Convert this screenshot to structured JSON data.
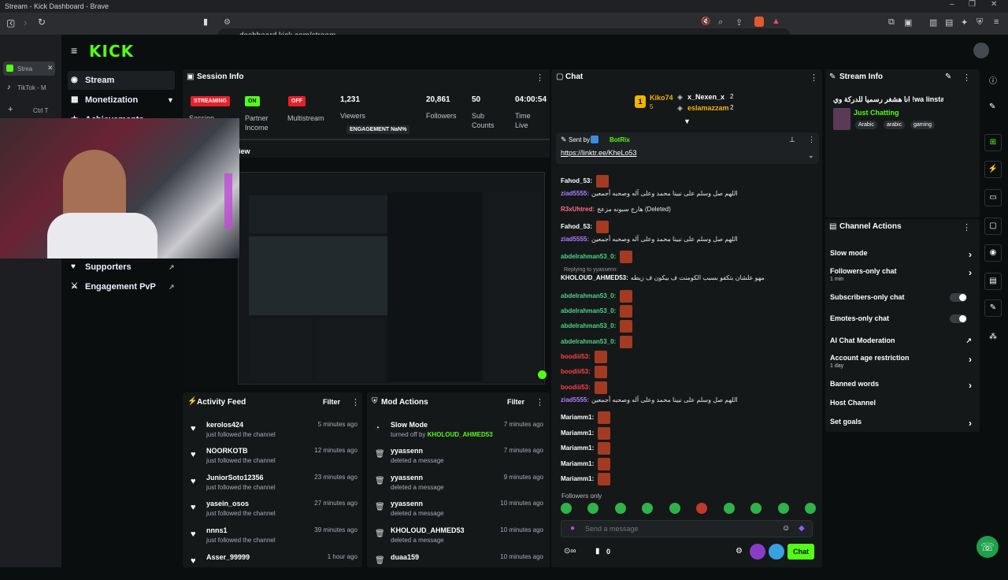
{
  "browser": {
    "tab_title": "Stream - Kick Dashboard - Brave",
    "url": "dashboard.kick.com/stream",
    "tabs": [
      {
        "label": "Strea"
      },
      {
        "label": "TikTok - M"
      }
    ],
    "shortcut": "Ctrl T"
  },
  "app": {
    "logo": "KICK"
  },
  "sidebar": {
    "items": [
      {
        "label": "Stream"
      },
      {
        "label": "Monetization"
      },
      {
        "label": "Achievements"
      },
      {
        "label": "Supporters"
      },
      {
        "label": "Engagement PvP"
      }
    ]
  },
  "session": {
    "title": "Session Info",
    "streaming_badge": "STREAMING",
    "session_label": "Session",
    "partner_badge": "ON",
    "partner_label_1": "Partner",
    "partner_label_2": "Income",
    "multistream_badge": "OFF",
    "multistream_label": "Multistream",
    "viewers_value": "1,231",
    "viewers_label": "Viewers",
    "engagement": "ENGAGEMENT NaN%",
    "followers_value": "20,861",
    "followers_label": "Followers",
    "subs_value": "50",
    "subs_label_1": "Sub",
    "subs_label_2": "Counts",
    "time_value": "04:00:54",
    "time_label_1": "Time",
    "time_label_2": "Live",
    "preview_label": "view"
  },
  "activity": {
    "title": "Activity Feed",
    "filter": "Filter",
    "rows": [
      {
        "name": "kerolos424",
        "sub": "just followed the channel",
        "time": "5 minutes ago"
      },
      {
        "name": "NOORKOTB",
        "sub": "just followed the channel",
        "time": "12 minutes ago"
      },
      {
        "name": "JuniorSoto12356",
        "sub": "just followed the channel",
        "time": "23 minutes ago"
      },
      {
        "name": "yasein_osos",
        "sub": "just followed the channel",
        "time": "27 minutes ago"
      },
      {
        "name": "nnns1",
        "sub": "just followed the channel",
        "time": "39 minutes ago"
      },
      {
        "name": "Asser_99999",
        "sub": "",
        "time": "1 hour ago"
      }
    ]
  },
  "mod": {
    "title": "Mod Actions",
    "filter": "Filter",
    "rows": [
      {
        "name": "Slow Mode",
        "sub": "turned off by ",
        "by": "KHOLOUD_AHMED53",
        "time": "7 minutes ago"
      },
      {
        "name": "yyassenn",
        "sub": "deleted a message",
        "by": "",
        "time": "7 minutes ago"
      },
      {
        "name": "yyassenn",
        "sub": "deleted a message",
        "by": "",
        "time": "9 minutes ago"
      },
      {
        "name": "yyassenn",
        "sub": "deleted a message",
        "by": "",
        "time": "10 minutes ago"
      },
      {
        "name": "KHOLOUD_AHMED53",
        "sub": "deleted a message",
        "by": "",
        "time": "10 minutes ago"
      },
      {
        "name": "duaa159",
        "sub": "",
        "by": "",
        "time": "10 minutes ago"
      }
    ]
  },
  "chat": {
    "title": "Chat",
    "leader1": "Kiko74",
    "leader1_count": "5",
    "leader2": "x_Nexen_x",
    "leader2_count": "2",
    "leader3": "eslamazzam",
    "leader3_count": "2",
    "pinned_by": "Sent by",
    "pinned_user": "BotRix",
    "pinned_link": "https://linktr.ee/KheLo53",
    "lines": [
      {
        "user": "Fahod_53:",
        "color": "#ffffff",
        "text": "",
        "emotes": 1
      },
      {
        "user": "ziad5555:",
        "color": "#b07cff",
        "text": "اللهم صل وسلم على نبينا محمد وعلى آله وصحبه أجمعين",
        "emotes": 0
      },
      {
        "user": "R3xUhtred:",
        "color": "#ff6b8a",
        "text": "هارج سبونه مزعج (Deleted)",
        "emotes": 0
      },
      {
        "user": "Fahod_53:",
        "color": "#ffffff",
        "text": "",
        "emotes": 1
      },
      {
        "user": "ziad5555:",
        "color": "#b07cff",
        "text": "اللهم صل وسلم على نبينا محمد وعلى آله وصحبه أجمعين",
        "emotes": 0
      },
      {
        "user": "abdelrahman53_0:",
        "color": "#4ed38a",
        "text": "",
        "emotes": 1
      },
      {
        "user": "KHOLOUD_AHMED53:",
        "color": "#ffffff",
        "text": "مهو علشان بتكفو بسبب الكومنت ف بيكون ف زيطه",
        "emotes": 0
      },
      {
        "user": "abdelrahman53_0:",
        "color": "#4ed38a",
        "text": "",
        "emotes": 1
      },
      {
        "user": "abdelrahman53_0:",
        "color": "#4ed38a",
        "text": "",
        "emotes": 1
      },
      {
        "user": "abdelrahman53_0:",
        "color": "#4ed38a",
        "text": "",
        "emotes": 1
      },
      {
        "user": "abdelrahman53_0:",
        "color": "#4ed38a",
        "text": "",
        "emotes": 1
      },
      {
        "user": "boodiii53:",
        "color": "#ff4040",
        "text": "",
        "emotes": 1
      },
      {
        "user": "boodiii53:",
        "color": "#ff4040",
        "text": "",
        "emotes": 1
      },
      {
        "user": "boodiii53:",
        "color": "#ff4040",
        "text": "",
        "emotes": 1
      },
      {
        "user": "ziad5555:",
        "color": "#b07cff",
        "text": "اللهم صل وسلم على نبينا محمد وعلى آله وصحبه أجمعين",
        "emotes": 0
      },
      {
        "user": "Mariamm1:",
        "color": "#ffffff",
        "text": "",
        "emotes": 1
      },
      {
        "user": "Mariamm1:",
        "color": "#ffffff",
        "text": "",
        "emotes": 1
      },
      {
        "user": "Mariamm1:",
        "color": "#ffffff",
        "text": "",
        "emotes": 1
      },
      {
        "user": "Mariamm1:",
        "color": "#ffffff",
        "text": "",
        "emotes": 1
      },
      {
        "user": "Mariamm1:",
        "color": "#ffffff",
        "text": "",
        "emotes": 1
      }
    ],
    "reply_to": "Replying to yyassenn:",
    "followers_only": "Followers only",
    "placeholder": "Send a message",
    "send": "Chat",
    "count": "0"
  },
  "streaminfo": {
    "title": "Stream Info",
    "stream_title": "انا هشغر رسميا للدركة وي !wa linstapay",
    "category": "Just Chatting",
    "tags": [
      "Arabic",
      "arabic",
      "gaming"
    ]
  },
  "actions": {
    "title": "Channel Actions",
    "rows": [
      {
        "label": "Slow mode",
        "sub": "",
        "ctrl": "chev"
      },
      {
        "label": "Followers-only chat",
        "sub": "1 min",
        "ctrl": "chev"
      },
      {
        "label": "Subscribers-only chat",
        "sub": "",
        "ctrl": "toggle"
      },
      {
        "label": "Emotes-only chat",
        "sub": "",
        "ctrl": "toggle"
      },
      {
        "label": "AI Chat Moderation",
        "sub": "",
        "ctrl": "ext"
      },
      {
        "label": "Account age restriction",
        "sub": "1 day",
        "ctrl": "chev"
      },
      {
        "label": "Banned words",
        "sub": "",
        "ctrl": "chev"
      },
      {
        "label": "Host Channel",
        "sub": "",
        "ctrl": "none"
      },
      {
        "label": "Set goals",
        "sub": "",
        "ctrl": "chev"
      }
    ]
  },
  "colors": {
    "brand": "#53fc18",
    "danger": "#e8202a",
    "panel": "#151819"
  }
}
